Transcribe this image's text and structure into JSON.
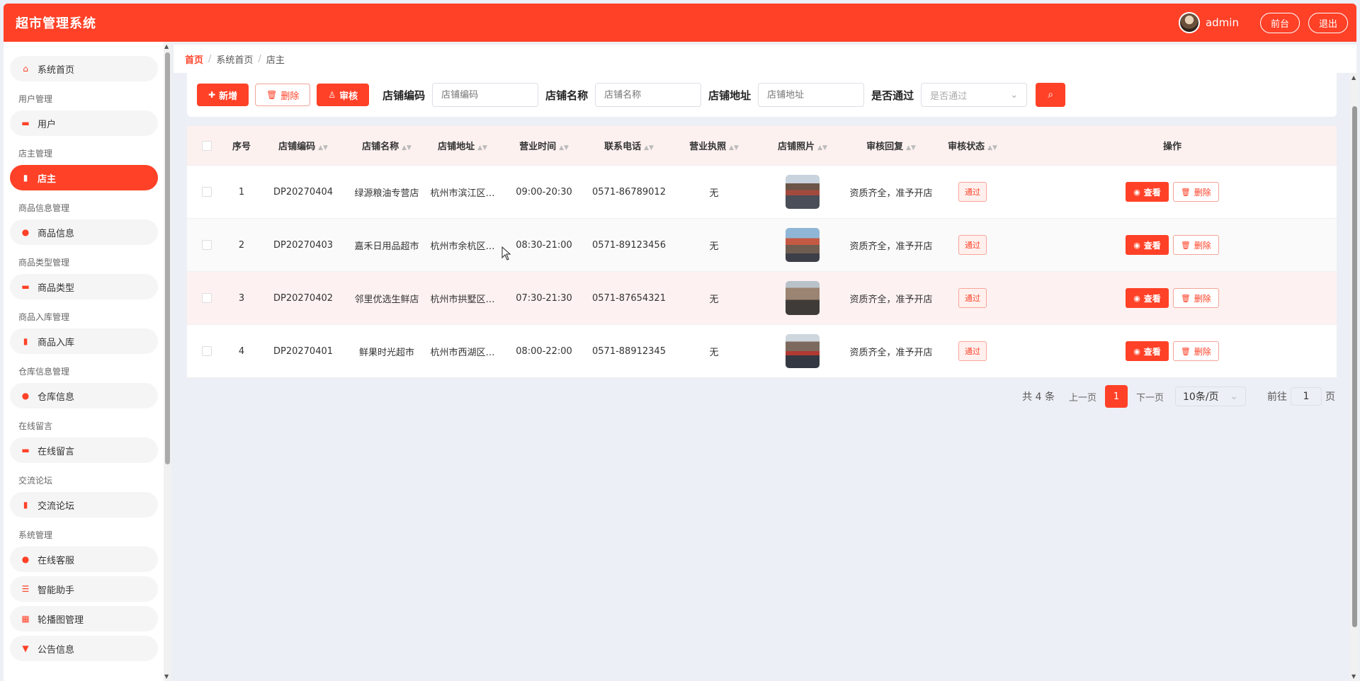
{
  "header": {
    "title": "超市管理系统",
    "username": "admin",
    "front_label": "前台",
    "logout_label": "退出"
  },
  "sidebar": {
    "items": [
      {
        "type": "item",
        "label": "系统首页",
        "icon": "home-icon",
        "glyph": "⌂"
      },
      {
        "type": "group",
        "label": "用户管理"
      },
      {
        "type": "item",
        "label": "用户",
        "icon": "briefcase-icon",
        "glyph": "▬"
      },
      {
        "type": "group",
        "label": "店主管理"
      },
      {
        "type": "item",
        "label": "店主",
        "icon": "bar-chart-icon",
        "glyph": "▮",
        "active": true
      },
      {
        "type": "group",
        "label": "商品信息管理"
      },
      {
        "type": "item",
        "label": "商品信息",
        "icon": "location-pin-icon",
        "glyph": "●"
      },
      {
        "type": "group",
        "label": "商品类型管理"
      },
      {
        "type": "item",
        "label": "商品类型",
        "icon": "briefcase-icon",
        "glyph": "▬"
      },
      {
        "type": "group",
        "label": "商品入库管理"
      },
      {
        "type": "item",
        "label": "商品入库",
        "icon": "bar-chart-icon",
        "glyph": "▮"
      },
      {
        "type": "group",
        "label": "仓库信息管理"
      },
      {
        "type": "item",
        "label": "仓库信息",
        "icon": "location-pin-icon",
        "glyph": "●"
      },
      {
        "type": "group",
        "label": "在线留言"
      },
      {
        "type": "item",
        "label": "在线留言",
        "icon": "briefcase-icon",
        "glyph": "▬"
      },
      {
        "type": "group",
        "label": "交流论坛"
      },
      {
        "type": "item",
        "label": "交流论坛",
        "icon": "bar-chart-icon",
        "glyph": "▮"
      },
      {
        "type": "group",
        "label": "系统管理"
      },
      {
        "type": "item",
        "label": "在线客服",
        "icon": "location-pin-icon",
        "glyph": "●"
      },
      {
        "type": "item",
        "label": "智能助手",
        "icon": "sliders-icon",
        "glyph": "☰"
      },
      {
        "type": "item",
        "label": "轮播图管理",
        "icon": "grid-icon",
        "glyph": "▦"
      },
      {
        "type": "item",
        "label": "公告信息",
        "icon": "announcement-icon",
        "glyph": "▼"
      }
    ]
  },
  "breadcrumb": {
    "home": "首页",
    "level1": "系统首页",
    "level2": "店主"
  },
  "toolbar": {
    "add_label": "新增",
    "delete_label": "删除",
    "audit_label": "审核"
  },
  "search": {
    "code_label": "店铺编码",
    "code_placeholder": "店铺编码",
    "name_label": "店铺名称",
    "name_placeholder": "店铺名称",
    "addr_label": "店铺地址",
    "addr_placeholder": "店铺地址",
    "pass_label": "是否通过",
    "pass_placeholder": "是否通过"
  },
  "table": {
    "columns": [
      "序号",
      "店铺编码",
      "店铺名称",
      "店铺地址",
      "营业时间",
      "联系电话",
      "营业执照",
      "店铺照片",
      "审核回复",
      "审核状态",
      "操作"
    ],
    "rows": [
      {
        "no": "1",
        "code": "DP20270404",
        "name": "绿源粮油专营店",
        "addr": "杭州市滨江区…",
        "time": "09:00-20:30",
        "tel": "0571-86789012",
        "license": "无",
        "reply": "资质齐全，准予开店",
        "status": "通过"
      },
      {
        "no": "2",
        "code": "DP20270403",
        "name": "嘉禾日用品超市",
        "addr": "杭州市余杭区…",
        "time": "08:30-21:00",
        "tel": "0571-89123456",
        "license": "无",
        "reply": "资质齐全，准予开店",
        "status": "通过"
      },
      {
        "no": "3",
        "code": "DP20270402",
        "name": "邻里优选生鲜店",
        "addr": "杭州市拱墅区…",
        "time": "07:30-21:30",
        "tel": "0571-87654321",
        "license": "无",
        "reply": "资质齐全，准予开店",
        "status": "通过"
      },
      {
        "no": "4",
        "code": "DP20270401",
        "name": "鲜果时光超市",
        "addr": "杭州市西湖区…",
        "time": "08:00-22:00",
        "tel": "0571-88912345",
        "license": "无",
        "reply": "资质齐全，准予开店",
        "status": "通过"
      }
    ],
    "view_label": "查看",
    "delete_label": "删除"
  },
  "pagination": {
    "total_text": "共 4 条",
    "prev": "上一页",
    "current": "1",
    "next": "下一页",
    "page_size": "10条/页",
    "goto_label": "前往",
    "goto_value": "1",
    "page_suffix": "页"
  },
  "colors": {
    "accent": "#ff4127",
    "background": "#eceff5"
  }
}
